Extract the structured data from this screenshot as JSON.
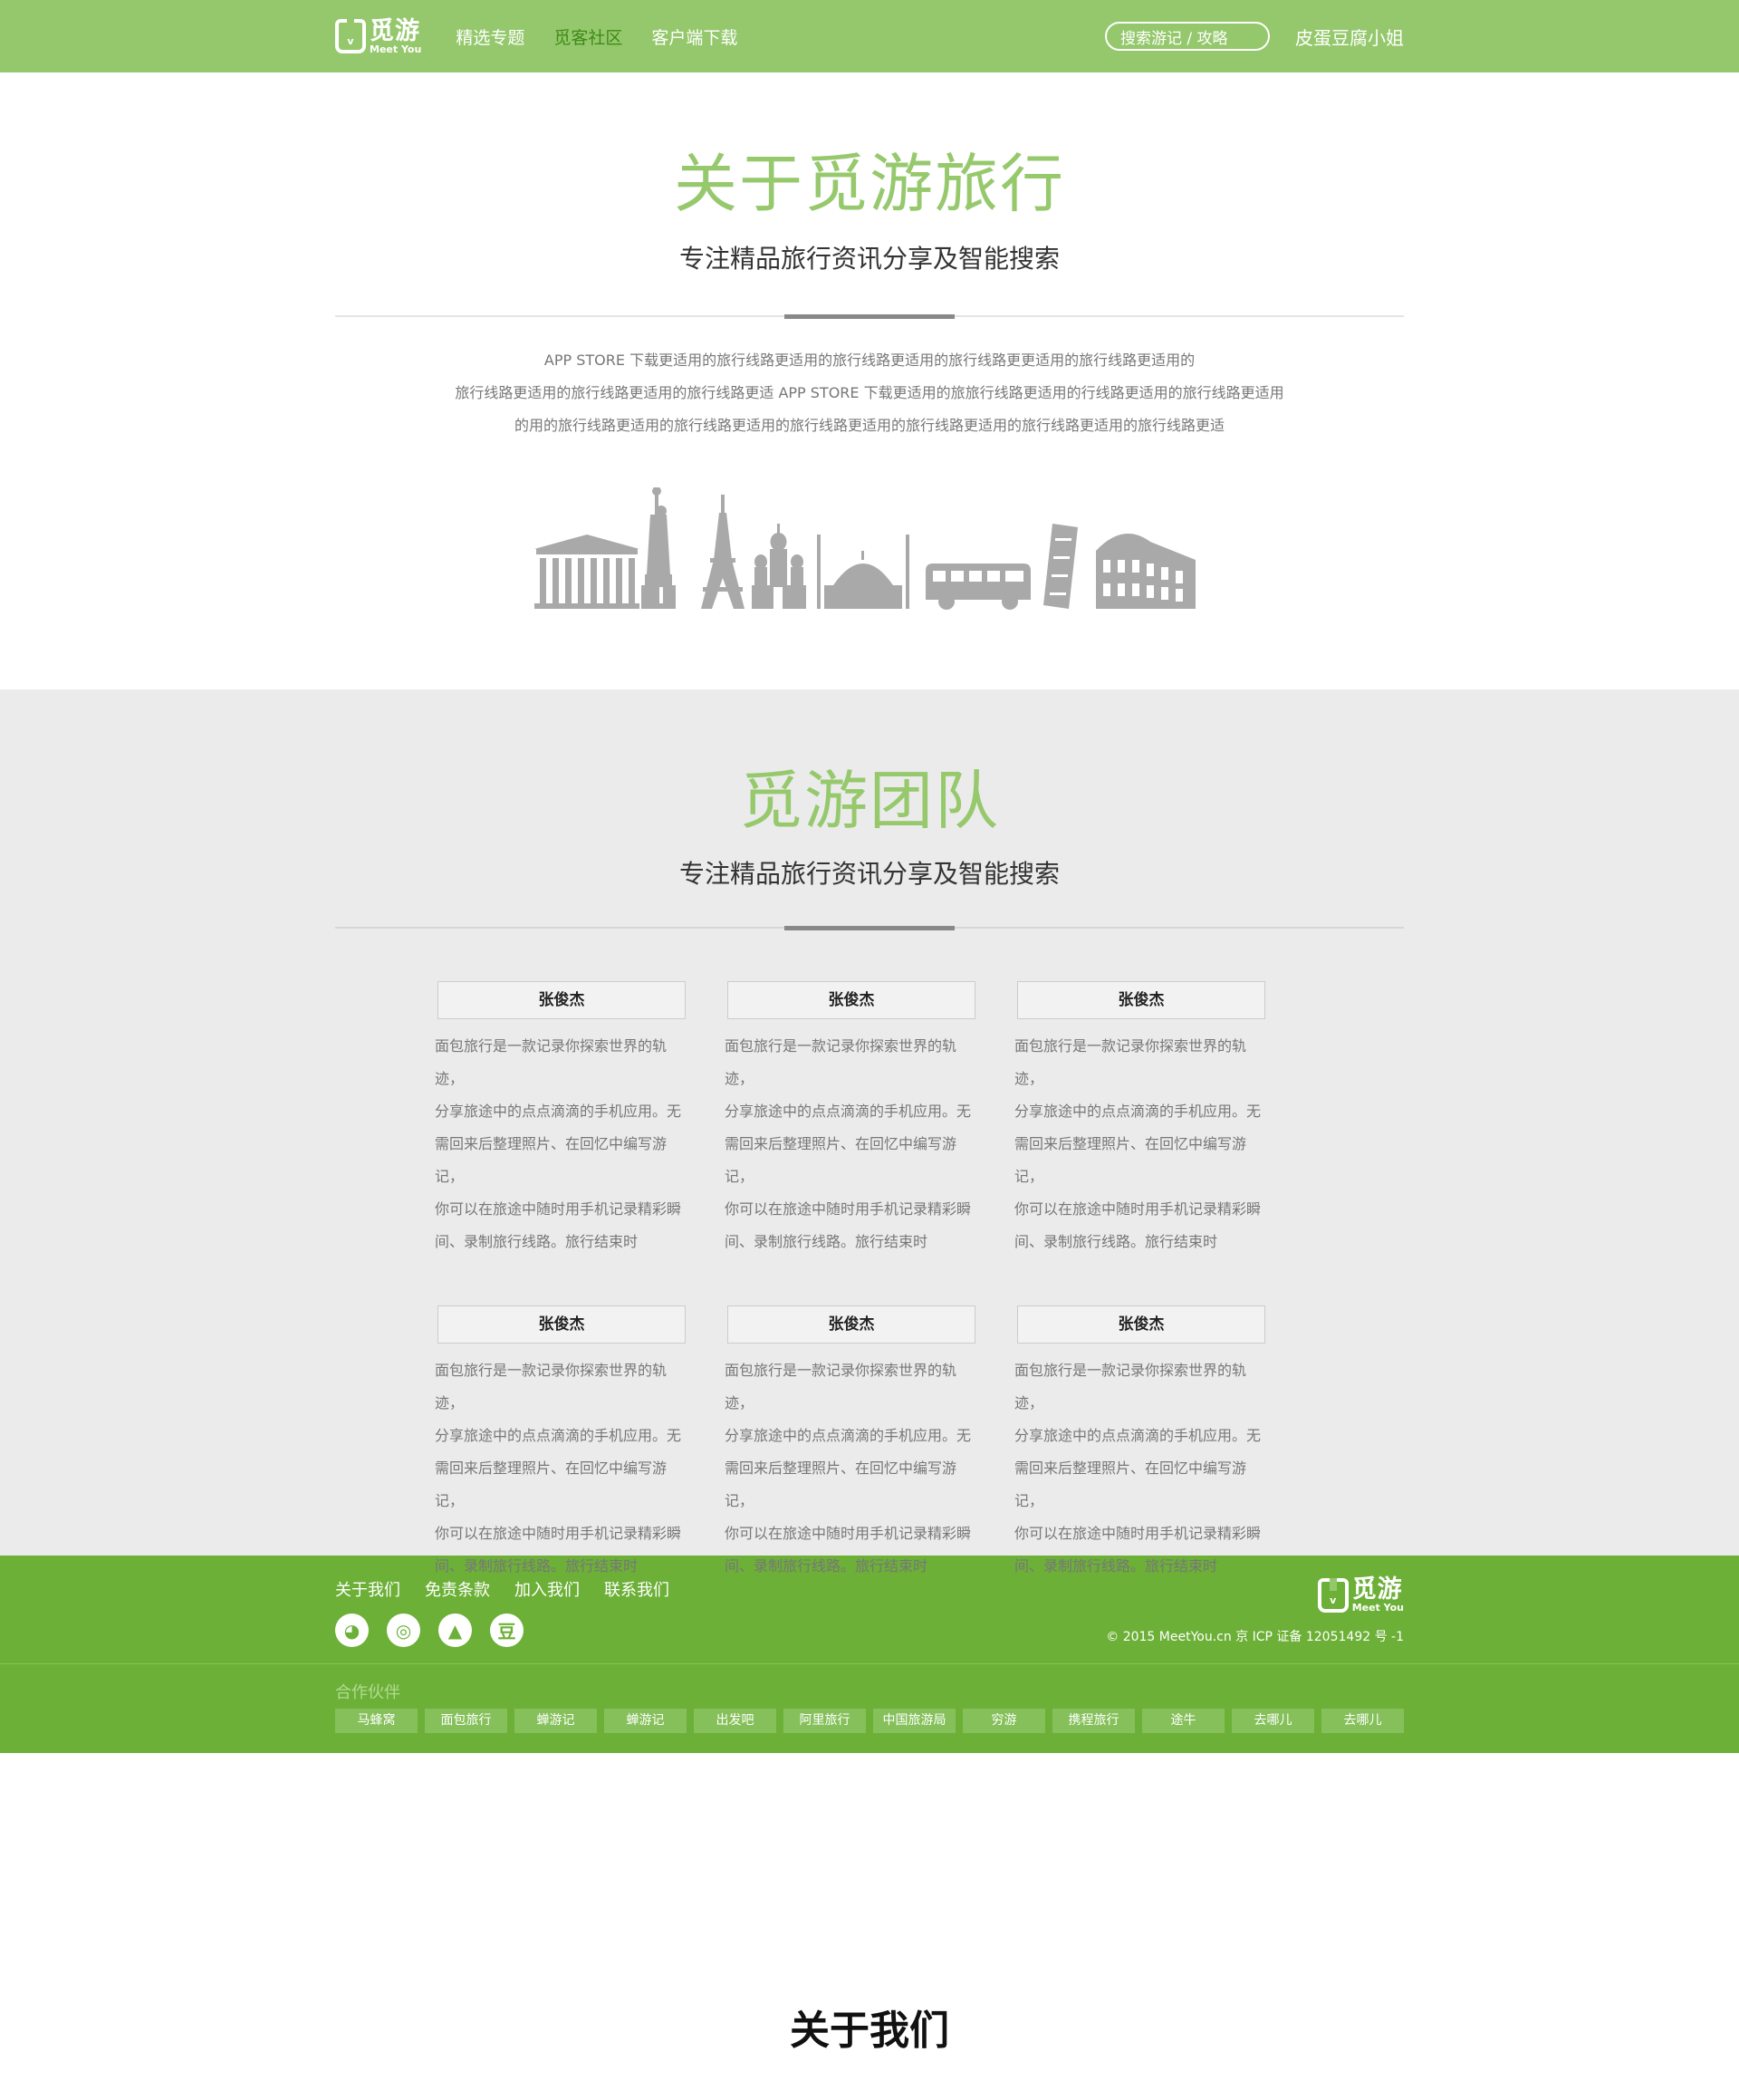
{
  "header": {
    "logo_cn": "觅游",
    "logo_en": "Meet You",
    "nav": [
      "精选专题",
      "觅客社区",
      "客户端下载"
    ],
    "search_placeholder": "搜索游记 / 攻略",
    "username": "皮蛋豆腐小姐"
  },
  "about": {
    "title": "关于觅游旅行",
    "subtitle": "专注精品旅行资讯分享及智能搜索",
    "lines": [
      "APP STORE 下载更适用的旅行线路更适用的旅行线路更适用的旅行线路更更适用的旅行线路更适用的",
      "旅行线路更适用的旅行线路更适用的旅行线路更适 APP STORE 下载更适用的旅旅行线路更适用的行线路更适用的旅行线路更适用",
      "的用的旅行线路更适用的旅行线路更适用的旅行线路更适用的旅行线路更适用的旅行线路更适用的旅行线路更适"
    ]
  },
  "team": {
    "title": "觅游团队",
    "subtitle": "专注精品旅行资讯分享及智能搜索",
    "members": [
      {
        "name": "张俊杰",
        "lines": [
          "面包旅行是一款记录你探索世界的轨迹，",
          "分享旅途中的点点滴滴的手机应用。无",
          "需回来后整理照片、在回忆中编写游记，",
          "你可以在旅途中随时用手机记录精彩瞬",
          "间、录制旅行线路。旅行结束时"
        ]
      },
      {
        "name": "张俊杰",
        "lines": [
          "面包旅行是一款记录你探索世界的轨迹，",
          "分享旅途中的点点滴滴的手机应用。无",
          "需回来后整理照片、在回忆中编写游记，",
          "你可以在旅途中随时用手机记录精彩瞬",
          "间、录制旅行线路。旅行结束时"
        ]
      },
      {
        "name": "张俊杰",
        "lines": [
          "面包旅行是一款记录你探索世界的轨迹，",
          "分享旅途中的点点滴滴的手机应用。无",
          "需回来后整理照片、在回忆中编写游记，",
          "你可以在旅途中随时用手机记录精彩瞬",
          "间、录制旅行线路。旅行结束时"
        ]
      },
      {
        "name": "张俊杰",
        "lines": [
          "面包旅行是一款记录你探索世界的轨迹，",
          "分享旅途中的点点滴滴的手机应用。无",
          "需回来后整理照片、在回忆中编写游记，",
          "你可以在旅途中随时用手机记录精彩瞬",
          "间、录制旅行线路。旅行结束时"
        ]
      },
      {
        "name": "张俊杰",
        "lines": [
          "面包旅行是一款记录你探索世界的轨迹，",
          "分享旅途中的点点滴滴的手机应用。无",
          "需回来后整理照片、在回忆中编写游记，",
          "你可以在旅途中随时用手机记录精彩瞬",
          "间、录制旅行线路。旅行结束时"
        ]
      },
      {
        "name": "张俊杰",
        "lines": [
          "面包旅行是一款记录你探索世界的轨迹，",
          "分享旅途中的点点滴滴的手机应用。无",
          "需回来后整理照片、在回忆中编写游记，",
          "你可以在旅途中随时用手机记录精彩瞬",
          "间、录制旅行线路。旅行结束时"
        ]
      }
    ]
  },
  "footer": {
    "links": [
      "关于我们",
      "免责条款",
      "加入我们",
      "联系我们"
    ],
    "socials": [
      {
        "icon": "wechat-icon",
        "glyph": "◕"
      },
      {
        "icon": "weibo-icon",
        "glyph": "◎"
      },
      {
        "icon": "qq-icon",
        "glyph": "▲"
      },
      {
        "icon": "douban-icon",
        "glyph": "豆"
      }
    ],
    "copyright": "© 2015 MeetYou.cn   京 ICP 证备 12051492 号 -1",
    "partners_label": "合作伙伴",
    "partners": [
      "马蜂窝",
      "面包旅行",
      "蝉游记",
      "蝉游记",
      "出发吧",
      "阿里旅行",
      "中国旅游局",
      "穷游",
      "携程旅行",
      "途牛",
      "去哪儿",
      "去哪儿"
    ]
  },
  "bottom_heading": "关于我们",
  "colors": {
    "brand_green": "#95c86c",
    "footer_green": "#6cb037",
    "active_nav": "#3e8a17",
    "team_bg": "#ebebeb"
  }
}
